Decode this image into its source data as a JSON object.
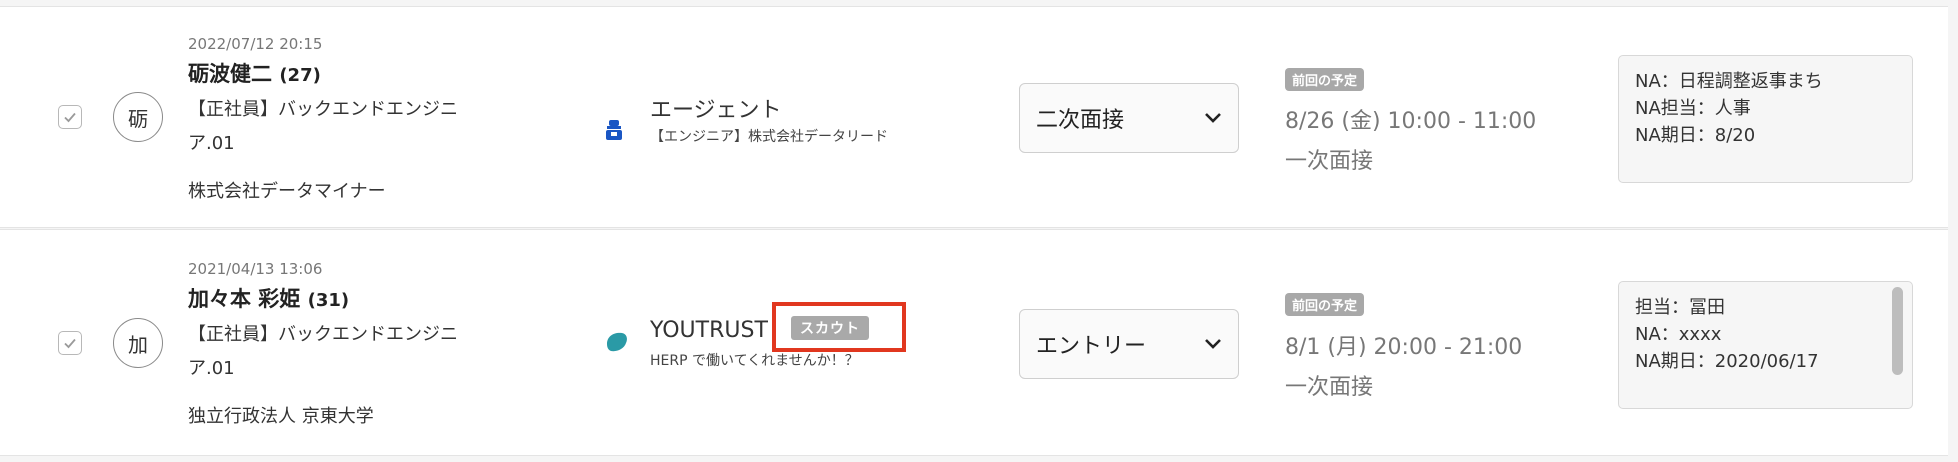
{
  "candidates": [
    {
      "date": "2022/07/12 20:15",
      "name": "砺波健二",
      "age": "(27)",
      "avatar": "砺",
      "position_line1": "【正社員】バックエンドエンジニ",
      "position_line2": "ア.01",
      "company": "株式会社データマイナー",
      "source": {
        "icon": "agent-icon",
        "name": "エージェント",
        "sub": "【エンジニア】株式会社データリード"
      },
      "status": "二次面接",
      "plan_label": "前回の予定",
      "plan_time": "8/26 (金) 10:00 - 11:00",
      "plan_type": "一次面接",
      "notes": [
        "NA：日程調整返事まち",
        "NA担当：人事",
        "NA期日：8/20"
      ]
    },
    {
      "date": "2021/04/13 13:06",
      "name": "加々本 彩姫",
      "age": "(31)",
      "avatar": "加",
      "position_line1": "【正社員】バックエンドエンジニ",
      "position_line2": "ア.01",
      "company": "独立行政法人 京東大学",
      "source": {
        "icon": "youtrust-icon",
        "name": "YOUTRUST",
        "badge": "スカウト",
        "sub": "HERP で働いてくれませんか！？"
      },
      "status": "エントリー",
      "plan_label": "前回の予定",
      "plan_time": "8/1 (月) 20:00 - 21:00",
      "plan_type": "一次面接",
      "notes": [
        "担当：冨田",
        "NA：xxxx",
        "NA期日：2020/06/17"
      ]
    }
  ],
  "colors": {
    "highlight": "#e1371f",
    "agent_icon": "#1a56c4",
    "youtrust_icon": "#2a9aa6"
  }
}
